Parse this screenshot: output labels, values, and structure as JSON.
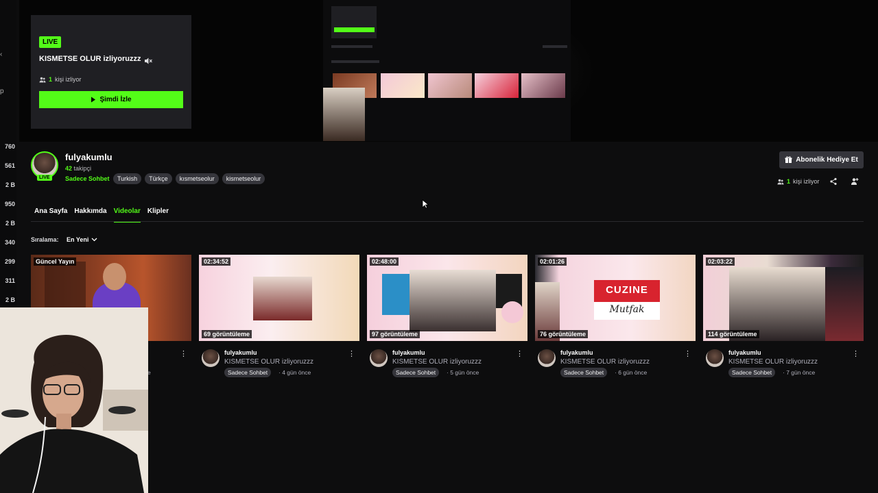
{
  "sidebar": {
    "counts": [
      "760",
      "561",
      "2 B",
      "950",
      "2 B",
      "340",
      "299",
      "311",
      "2 B"
    ],
    "mark": "p"
  },
  "live_card": {
    "badge": "LIVE",
    "title": "KISMETSE OLUR izliyoruzzz",
    "viewers_count": "1",
    "viewers_label": "kişi izliyor",
    "watch_label": "Şimdi İzle"
  },
  "channel": {
    "name": "fulyakumlu",
    "followers_count": "42",
    "followers_label": "takipçi",
    "avatar_badge": "LIVE",
    "category": "Sadece Sohbet",
    "tags": [
      "Turkish",
      "Türkçe",
      "kısmetseolur",
      "kismetseolur"
    ],
    "gift_label": "Abonelik Hediye Et",
    "viewers_count": "1",
    "viewers_label": "kişi izliyor"
  },
  "tabs": [
    {
      "label": "Ana Sayfa",
      "active": false
    },
    {
      "label": "Hakkımda",
      "active": false
    },
    {
      "label": "Videolar",
      "active": true
    },
    {
      "label": "Klipler",
      "active": false
    }
  ],
  "sort": {
    "label": "Sıralama:",
    "value": "En Yeni"
  },
  "videos": [
    {
      "duration": "Güncel Yayın",
      "views": "",
      "channel": "",
      "title": "",
      "category": "",
      "age": "e"
    },
    {
      "duration": "02:34:52",
      "views": "69 görüntüleme",
      "channel": "fulyakumlu",
      "title": "KISMETSE OLUR izliyoruzzz",
      "category": "Sadece Sohbet",
      "age": "· 4 gün önce"
    },
    {
      "duration": "02:48:00",
      "views": "97 görüntüleme",
      "channel": "fulyakumlu",
      "title": "KISMETSE OLUR izliyoruzzz",
      "category": "Sadece Sohbet",
      "age": "· 5 gün önce"
    },
    {
      "duration": "02:01:26",
      "views": "76 görüntüleme",
      "channel": "fulyakumlu",
      "title": "KISMETSE OLUR izliyoruzzz",
      "category": "Sadece Sohbet",
      "age": "· 6 gün önce"
    },
    {
      "duration": "02:03:22",
      "views": "114 görüntüleme",
      "channel": "fulyakumlu",
      "title": "KISMETSE OLUR izliyoruzzz",
      "category": "Sadece Sohbet",
      "age": "· 7 gün önce"
    }
  ],
  "thumb_texts": {
    "cuzine": "CUZINE",
    "mutfak": "Mutfak"
  },
  "colors": {
    "accent": "#53fc18",
    "background": "#0d0d0e",
    "tag_bg": "#35353b"
  }
}
